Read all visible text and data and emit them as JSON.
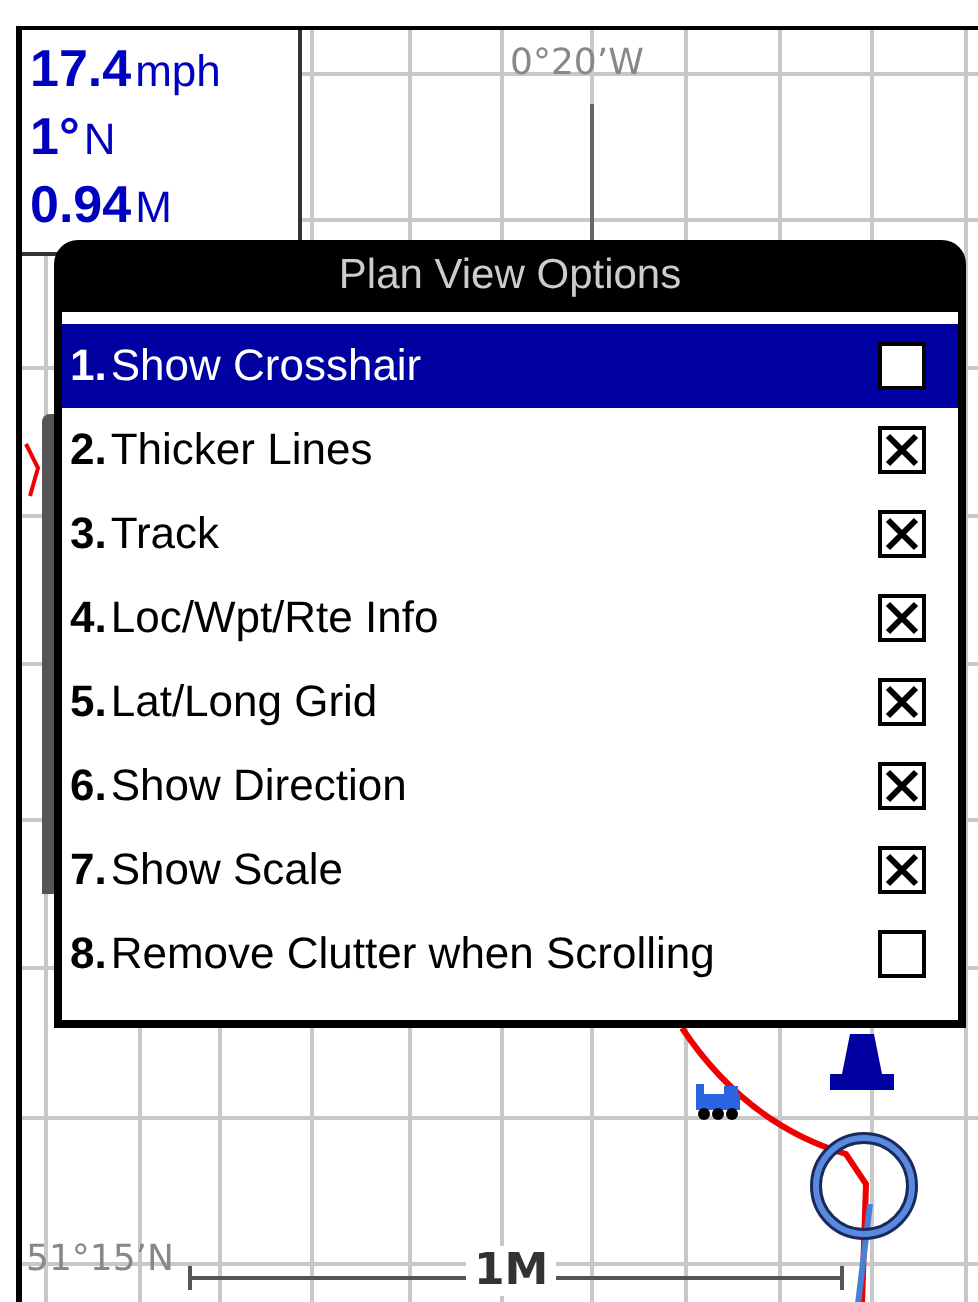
{
  "info": {
    "speed": "17.4",
    "speed_unit": "mph",
    "heading": "1°",
    "heading_unit": "N",
    "distance": "0.94",
    "distance_unit": "M"
  },
  "map": {
    "longitude_label": "0°20’W",
    "latitude_label": "51°15’N",
    "scale_label": "1M"
  },
  "dialog": {
    "title": "Plan View Options",
    "items": [
      {
        "number": "1.",
        "label": "Show Crosshair",
        "checked": false,
        "selected": true
      },
      {
        "number": "2.",
        "label": "Thicker Lines",
        "checked": true,
        "selected": false
      },
      {
        "number": "3.",
        "label": "Track",
        "checked": true,
        "selected": false
      },
      {
        "number": "4.",
        "label": "Loc/Wpt/Rte Info",
        "checked": true,
        "selected": false
      },
      {
        "number": "5.",
        "label": "Lat/Long Grid",
        "checked": true,
        "selected": false
      },
      {
        "number": "6.",
        "label": "Show Direction",
        "checked": true,
        "selected": false
      },
      {
        "number": "7.",
        "label": "Show Scale",
        "checked": true,
        "selected": false
      },
      {
        "number": "8.",
        "label": "Remove Clutter when Scrolling",
        "checked": false,
        "selected": false
      }
    ]
  }
}
